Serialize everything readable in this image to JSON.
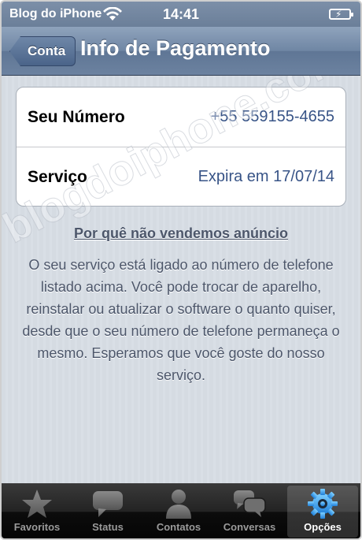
{
  "status_bar": {
    "carrier": "Blog do iPhone",
    "time": "14:41",
    "wifi_icon": "wifi-icon",
    "battery_icon": "battery-charging-icon"
  },
  "nav": {
    "back_label": "Conta",
    "title": "Info de Pagamento"
  },
  "account": {
    "rows": [
      {
        "label": "Seu Número",
        "value": "+55 559155-4655"
      },
      {
        "label": "Serviço",
        "value": "Expira em 17/07/14"
      }
    ]
  },
  "info": {
    "heading": "Por quê não vendemos anúncio",
    "body": "O seu serviço está ligado ao número de telefone listado acima. Você pode trocar de aparelho, reinstalar ou atualizar o software o quanto quiser, desde que o seu número de telefone permaneça o mesmo. Esperamos que você goste do nosso serviço."
  },
  "watermark": "blogdoiphone.com",
  "tab_bar": {
    "tabs": [
      {
        "label": "Favoritos",
        "icon": "star-icon",
        "active": false
      },
      {
        "label": "Status",
        "icon": "speech-bubble-icon",
        "active": false
      },
      {
        "label": "Contatos",
        "icon": "person-icon",
        "active": false
      },
      {
        "label": "Conversas",
        "icon": "chat-bubbles-icon",
        "active": false
      },
      {
        "label": "Opções",
        "icon": "gear-icon",
        "active": true
      }
    ],
    "active_color": "#3aa0f0"
  }
}
